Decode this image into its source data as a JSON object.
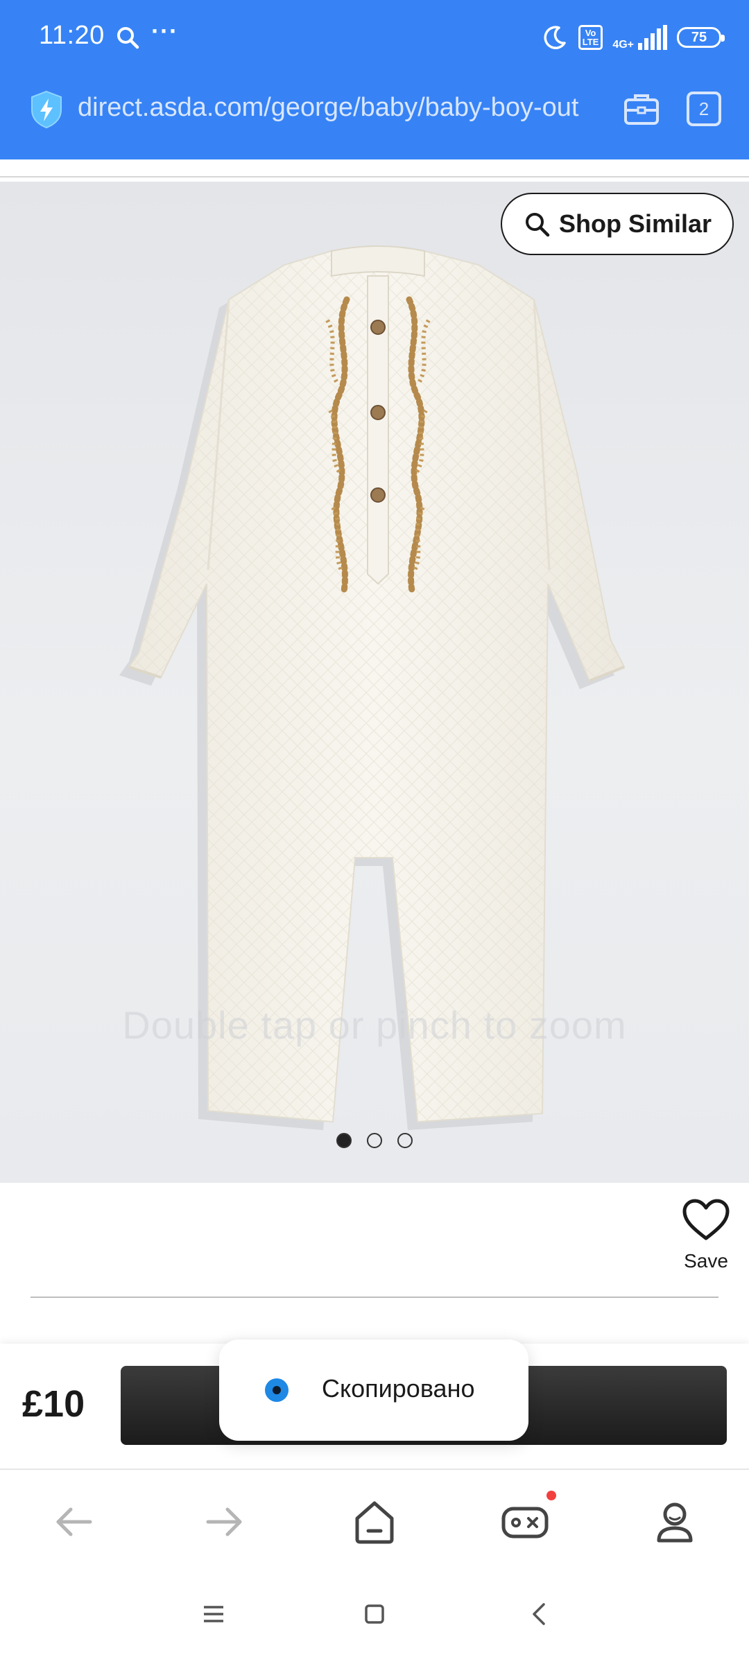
{
  "status_bar": {
    "time": "11:20",
    "more": "···",
    "volte": "Vo\nLTE",
    "network": "4G+",
    "battery": "75"
  },
  "browser": {
    "url": "direct.asda.com/george/baby/baby-boy-out",
    "tab_count": "2"
  },
  "product": {
    "shop_similar_label": "Shop Similar",
    "zoom_hint": "Double tap or pinch to zoom",
    "image_count": 3,
    "active_image": 1,
    "save_label": "Save",
    "price": "£10"
  },
  "toast": {
    "text": "Скопировано"
  },
  "colors": {
    "header_bg": "#3783f5",
    "cta_bg": "#1b1b1b",
    "toast_icon": "#1e88e5",
    "notification_dot": "#f2403e",
    "embroidery": "#b58a4c"
  },
  "icons": {
    "status": [
      "search-icon",
      "more-icon",
      "moon-icon",
      "volte-icon",
      "signal-icon",
      "battery-icon"
    ],
    "browser": [
      "shield-lightning-icon",
      "toolbox-icon",
      "tabs-icon"
    ],
    "bottom_nav": [
      "back-arrow-icon",
      "forward-arrow-icon",
      "home-icon",
      "gamepad-icon",
      "profile-icon"
    ],
    "system_nav": [
      "menu-icon",
      "home-square-icon",
      "back-chevron-icon"
    ]
  }
}
